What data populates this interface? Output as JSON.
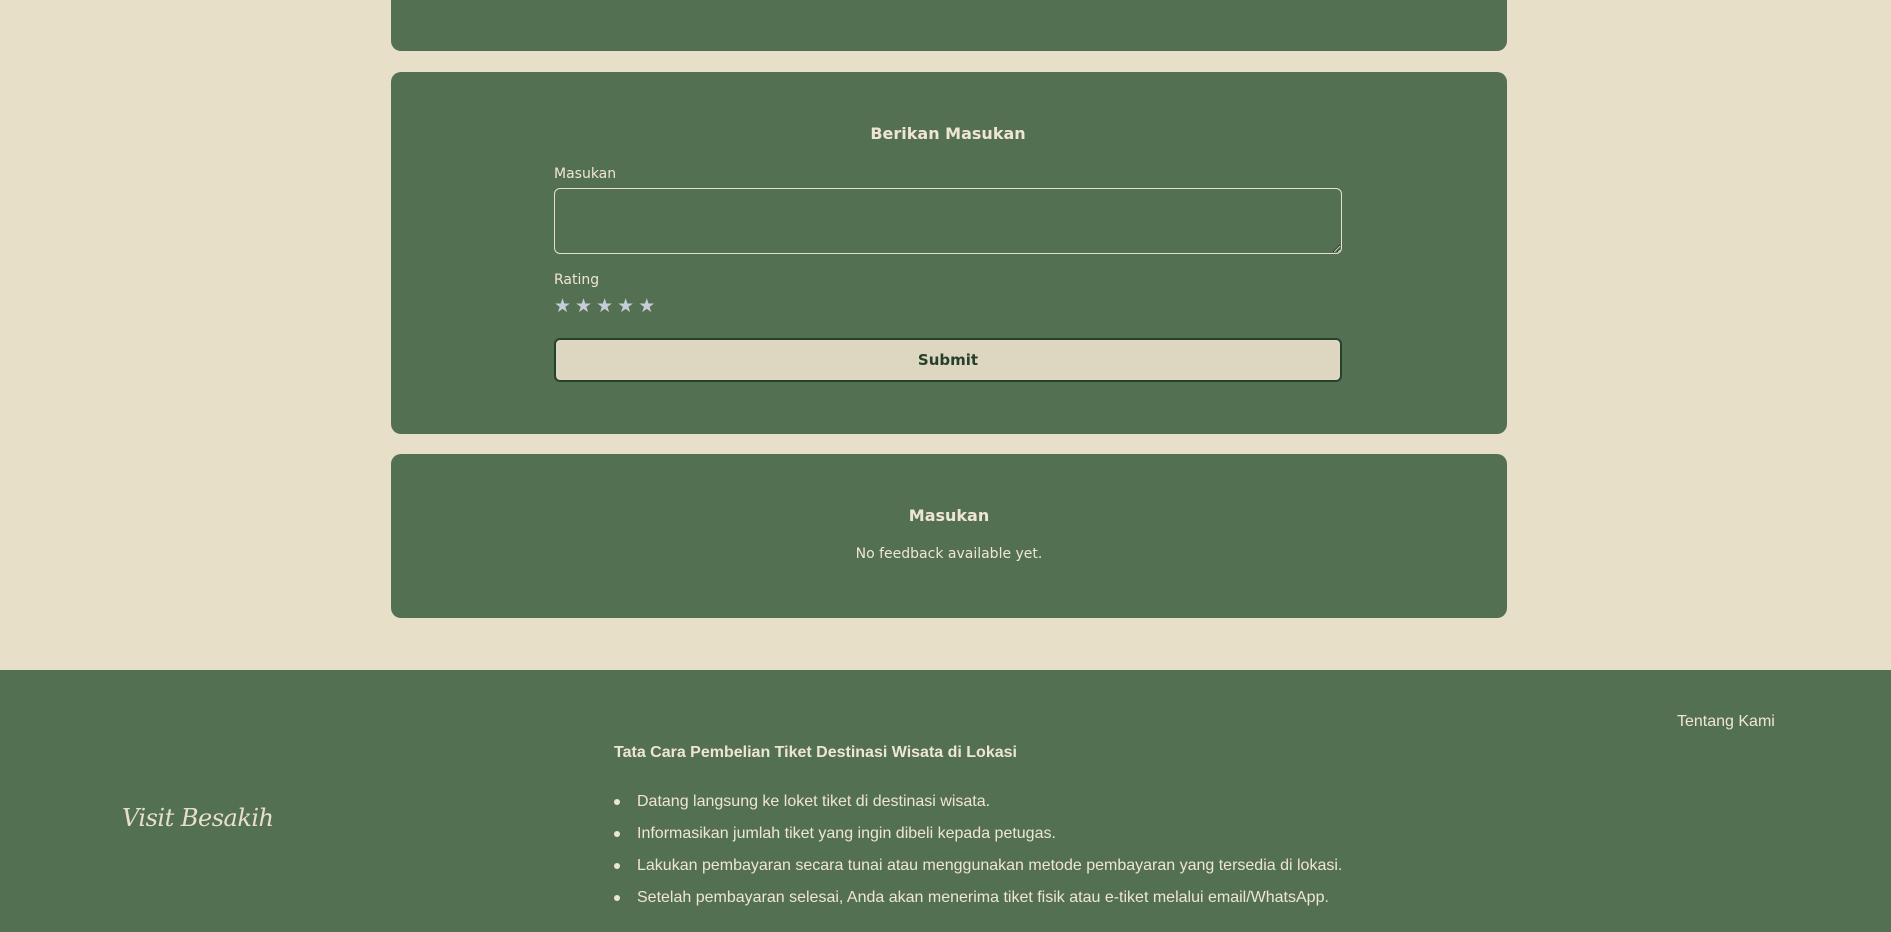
{
  "colors": {
    "page_background": "#e8dfc9",
    "card_background": "#537052",
    "text_light": "#efe6d2",
    "button_background": "#ddd6c0",
    "button_text": "#26402a",
    "star_color": "#c7cdd8"
  },
  "feedback_form": {
    "title": "Berikan Masukan",
    "masukan_label": "Masukan",
    "masukan_value": "",
    "rating_label": "Rating",
    "rating_value": 0,
    "rating_max": 5,
    "star_glyph": "★",
    "submit_label": "Submit"
  },
  "feedback_list": {
    "title": "Masukan",
    "empty_message": "No feedback available yet."
  },
  "footer": {
    "brand": "Visit Besakih",
    "about_link": "Tentang Kami",
    "howto_title": "Tata Cara Pembelian Tiket Destinasi Wisata di Lokasi",
    "howto_steps": [
      "Datang langsung ke loket tiket di destinasi wisata.",
      "Informasikan jumlah tiket yang ingin dibeli kepada petugas.",
      "Lakukan pembayaran secara tunai atau menggunakan metode pembayaran yang tersedia di lokasi.",
      "Setelah pembayaran selesai, Anda akan menerima tiket fisik atau e-tiket melalui email/WhatsApp."
    ]
  }
}
